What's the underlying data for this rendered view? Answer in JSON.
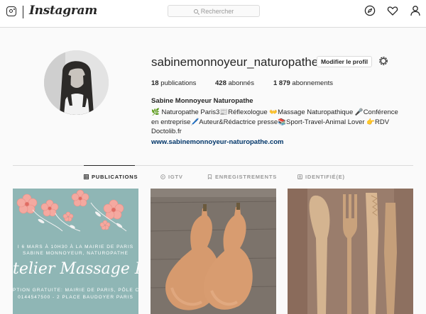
{
  "topbar": {
    "wordmark": "Instagram",
    "search_placeholder": "Rechercher",
    "icons": [
      "instagram-glyph-icon",
      "explore-compass-icon",
      "heart-icon",
      "profile-person-icon"
    ]
  },
  "profile": {
    "username": "sabinemonnoyeur_naturopathe",
    "edit_button": "Modifier le profil",
    "stats": {
      "posts_count": "18",
      "posts_label": "publications",
      "followers_count": "428",
      "followers_label": "abonnés",
      "following_count": "1 879",
      "following_label": "abonnements"
    },
    "full_name": "Sabine Monnoyeur Naturopathe",
    "bio_lines": [
      "🌿 Naturopathe Paris3📰Réflexologue 👐Massage Naturopathique 🎤Conférence",
      "en entreprise🖊️Auteur&Rédactrice presse📚Sport-Travel-Animal Lover 👉RDV",
      "Doctolib.fr"
    ],
    "website": "www.sabinemonnoyeur-naturopathe.com"
  },
  "tabs": [
    {
      "label": "PUBLICATIONS",
      "icon": "grid-icon",
      "active": true
    },
    {
      "label": "IGTV",
      "icon": "igtv-icon",
      "active": false
    },
    {
      "label": "ENREGISTREMENTS",
      "icon": "bookmark-icon",
      "active": false
    },
    {
      "label": "IDENTIFIÉ(E)",
      "icon": "tagged-icon",
      "active": false
    }
  ],
  "posts": [
    {
      "kind": "event-flyer",
      "lines": [
        "I 6 MARS À 10H30 À LA MAIRIE DE PARIS",
        "SABINE MONNOYEUR, NATUROPATHE"
      ],
      "script_title": "telier Massage B",
      "footer_lines": [
        "PTION GRATUITE: MAIRIE DE PARIS, PÔLE C",
        "0144547500 - 2 PLACE BAUDOYER PARIS"
      ]
    },
    {
      "kind": "photo-butternut-squash"
    },
    {
      "kind": "photo-wooden-utensils"
    }
  ],
  "colors": {
    "background": "#fafafa",
    "border": "#dbdbdb",
    "text": "#262626",
    "muted": "#999999",
    "link": "#003569",
    "flyer_teal": "#8fb6b5",
    "flyer_flower": "#f4a9a0"
  }
}
